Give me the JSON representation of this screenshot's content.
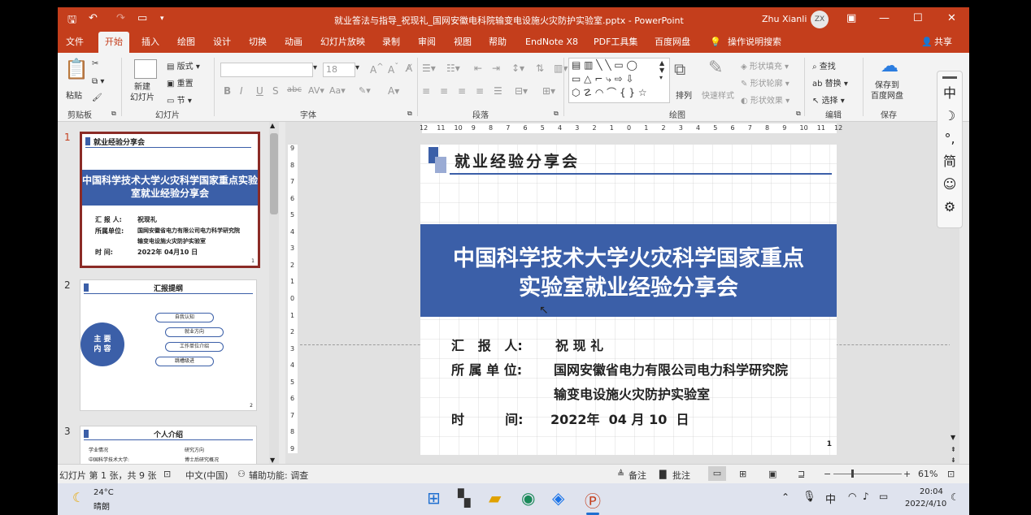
{
  "window": {
    "title": "就业答法与指导_祝现礼_国网安徽电科院输变电设施火灾防护实验室.pptx  -  PowerPoint",
    "user": "Zhu Xianli",
    "avatar": "ZX"
  },
  "tabs": [
    "文件",
    "开始",
    "插入",
    "绘图",
    "设计",
    "切换",
    "动画",
    "幻灯片放映",
    "录制",
    "审阅",
    "视图",
    "帮助",
    "EndNote X8",
    "PDF工具集",
    "百度网盘",
    "操作说明搜索"
  ],
  "share": "共享",
  "ribbon": {
    "clipboard": {
      "label": "剪贴板",
      "paste": "粘贴"
    },
    "slides": {
      "label": "幻灯片",
      "new_slide": "新建\n幻灯片",
      "layout": "版式",
      "reset": "重置",
      "section": "节"
    },
    "font": {
      "label": "字体",
      "size": "18"
    },
    "paragraph": {
      "label": "段落"
    },
    "drawing": {
      "label": "绘图",
      "arrange": "排列",
      "quick_styles": "快速样式",
      "fill": "形状填充",
      "outline": "形状轮廓",
      "effects": "形状效果"
    },
    "editing": {
      "label": "编辑",
      "find": "查找",
      "replace": "替换",
      "select": "选择"
    },
    "save": {
      "label": "保存",
      "button": "保存到\n百度网盘"
    }
  },
  "thumbnails": [
    {
      "num": "1",
      "header": "就业经验分享会",
      "title": "中国科学技术大学火灾科学国家重点实验室就业经验分享会",
      "rows": [
        [
          "汇 报 人:",
          "祝现礼"
        ],
        [
          "所属单位:",
          "国网安徽省电力有限公司电力科学研究院"
        ],
        [
          "",
          "输变电设施火灾防护实验室"
        ],
        [
          "时    间:",
          "2022年 04月10 日"
        ]
      ],
      "page": "1"
    },
    {
      "num": "2",
      "header": "汇报提纲",
      "circle": "主 要\n内 容",
      "items": [
        "自我认知",
        "就业方向",
        "工作单位介绍",
        "跳槽级进"
      ],
      "page": "2"
    },
    {
      "num": "3",
      "header": "个人介绍",
      "items": [
        "学业情况",
        "中国科学技术大学:",
        "研究方向",
        "博士后研究概况"
      ]
    }
  ],
  "slide": {
    "header": "就业经验分享会",
    "title_line1": "中国科学技术大学火灾科学国家重点",
    "title_line2": "实验室就业经验分享会",
    "rows": [
      {
        "label": "汇   报   人:",
        "value": "祝 现 礼"
      },
      {
        "label": "所 属 单 位:",
        "value": "国网安徽省电力有限公司电力科学研究院"
      },
      {
        "label": "",
        "value": "输变电设施火灾防护实验室"
      },
      {
        "label": "时         间:",
        "value": "2022年  04 月 10  日"
      }
    ],
    "page": "1"
  },
  "ruler": {
    "h_ticks": [
      "12",
      "11",
      "10",
      "9",
      "8",
      "7",
      "6",
      "5",
      "4",
      "3",
      "2",
      "1",
      "0",
      "1",
      "2",
      "3",
      "4",
      "5",
      "6",
      "7",
      "8",
      "9",
      "10",
      "11",
      "12"
    ]
  },
  "ime": [
    "中",
    "☽",
    "°,",
    "简",
    "☺",
    "⚙"
  ],
  "status": {
    "slide_info": "幻灯片 第 1 张，共 9 张",
    "language": "中文(中国)",
    "accessibility": "辅助功能: 调查",
    "notes": "备注",
    "comments": "批注",
    "zoom": "61%"
  },
  "taskbar": {
    "temp": "24°C",
    "weather": "晴朗",
    "ime": "中",
    "time": "20:04",
    "date": "2022/4/10"
  },
  "colors": {
    "accent": "#c43e1c",
    "banner": "#3b5fa8",
    "thumb_selected": "#8b2b26"
  }
}
